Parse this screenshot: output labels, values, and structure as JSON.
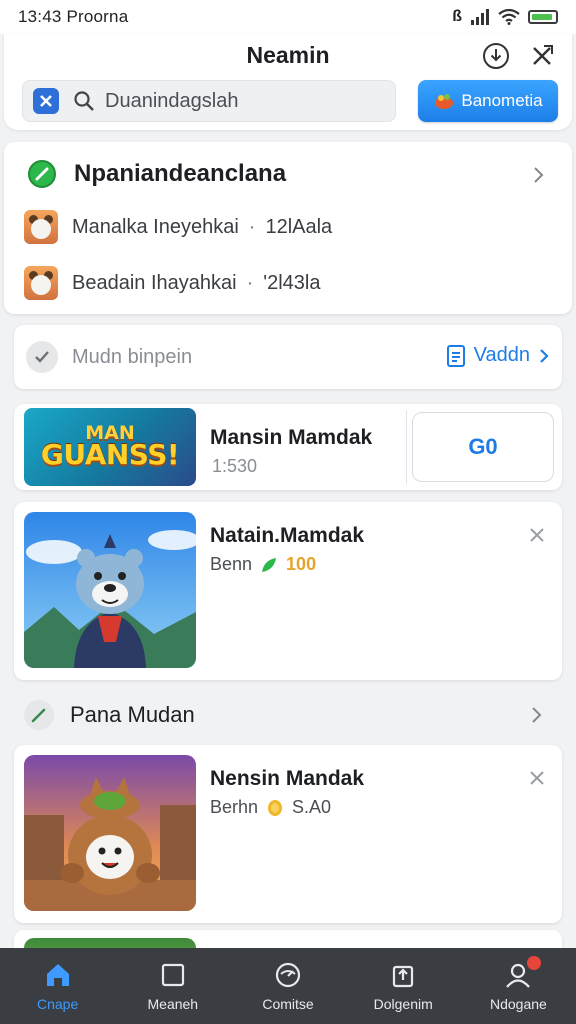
{
  "status_bar": {
    "time": "13:43 Proorna",
    "signal_text": "ß"
  },
  "header": {
    "title": "Neamin",
    "search_placeholder": "Duanindagslah",
    "promo_button": "Banometia"
  },
  "section_one": {
    "title": "Npaniandeanclana",
    "rows": [
      {
        "name": "Manalka Ineyehkai",
        "value": "12lAala"
      },
      {
        "name": "Beadain Ihayahkai",
        "value": "'2l43la"
      }
    ]
  },
  "sub_row": {
    "label": "Mudn binpein",
    "link": "Vaddn"
  },
  "banner_game": {
    "art_line1": "MAN",
    "art_line2": "GUANSS!",
    "title": "Mansin Mamdak",
    "subtitle": "1:530",
    "action": "G0"
  },
  "card_one": {
    "title": "Natain.Mamdak",
    "meta_label": "Benn",
    "meta_value": "100"
  },
  "section_two": {
    "title": "Pana Mudan"
  },
  "card_two": {
    "title": "Nensin Mandak",
    "meta_label": "Berhn",
    "meta_value": "S.A0"
  },
  "tabbar": {
    "tabs": [
      {
        "label": "Cnape",
        "icon": "home-icon",
        "active": true
      },
      {
        "label": "Meaneh",
        "icon": "square-icon",
        "active": false
      },
      {
        "label": "Comitse",
        "icon": "gauge-icon",
        "active": false
      },
      {
        "label": "Dolgenim",
        "icon": "upload-icon",
        "active": false
      },
      {
        "label": "Ndogane",
        "icon": "profile-icon",
        "active": false
      }
    ]
  },
  "colors": {
    "accent": "#1e7ce6",
    "tab_bar": "#3a3d42",
    "green": "#2db84b",
    "gold": "#e6a52a"
  }
}
